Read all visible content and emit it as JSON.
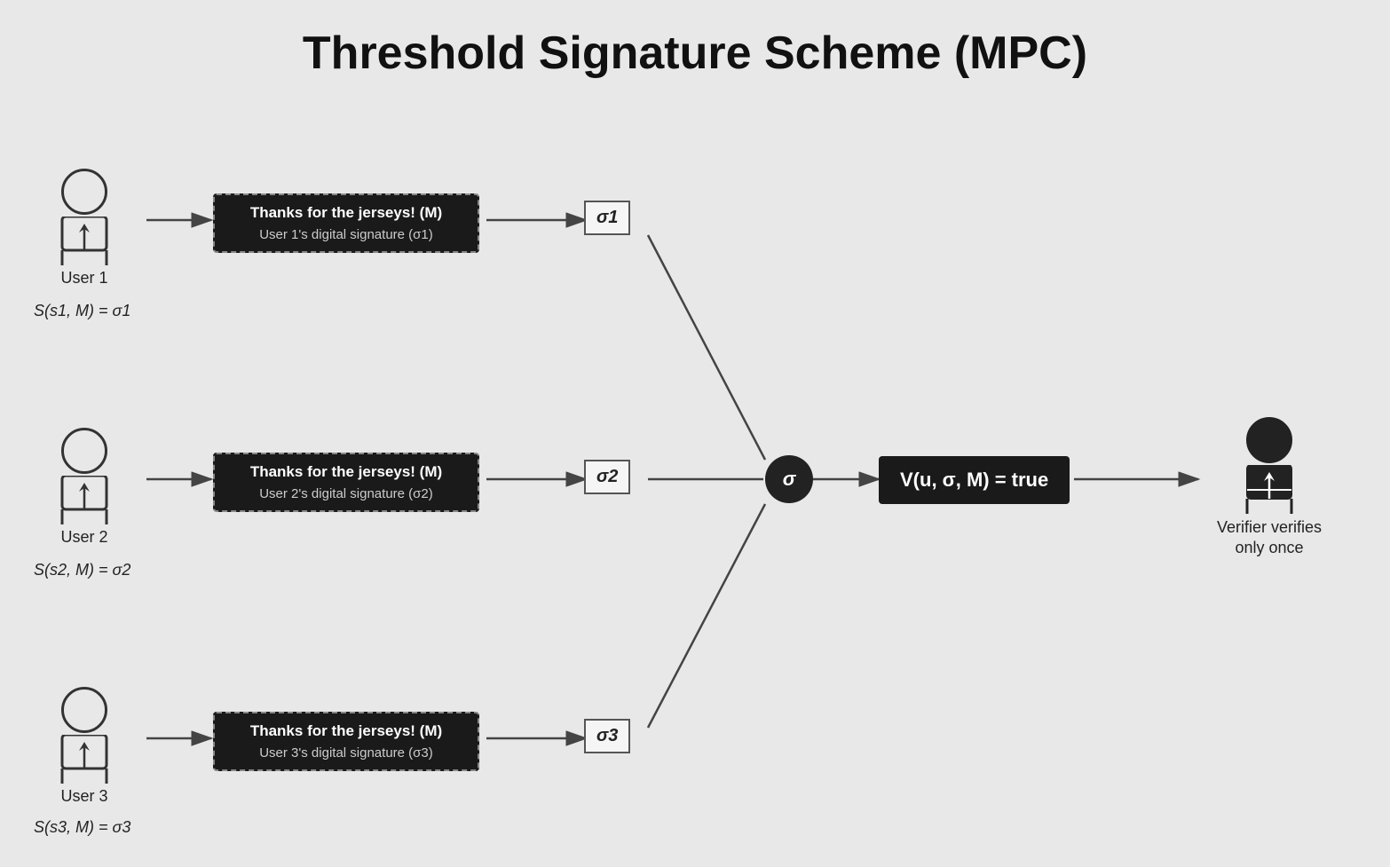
{
  "title": "Threshold Signature Scheme (MPC)",
  "users": [
    {
      "id": "user1",
      "label": "User 1",
      "formula": "S(s1, M) = σ1",
      "msg_title": "Thanks for the jerseys! (M)",
      "msg_sub": "User 1's digital signature (σ1)"
    },
    {
      "id": "user2",
      "label": "User 2",
      "formula": "S(s2, M) = σ2",
      "msg_title": "Thanks for the jerseys! (M)",
      "msg_sub": "User 2's digital signature (σ2)"
    },
    {
      "id": "user3",
      "label": "User 3",
      "formula": "S(s3, M) = σ3",
      "msg_title": "Thanks for the jerseys! (M)",
      "msg_sub": "User 3's digital signature (σ3)"
    }
  ],
  "sigma_labels": [
    "σ1",
    "σ2",
    "σ3"
  ],
  "agg_label": "σ",
  "verify_label": "V(u, σ, M) = true",
  "verifier_label": "Verifier verifies\nonly once"
}
